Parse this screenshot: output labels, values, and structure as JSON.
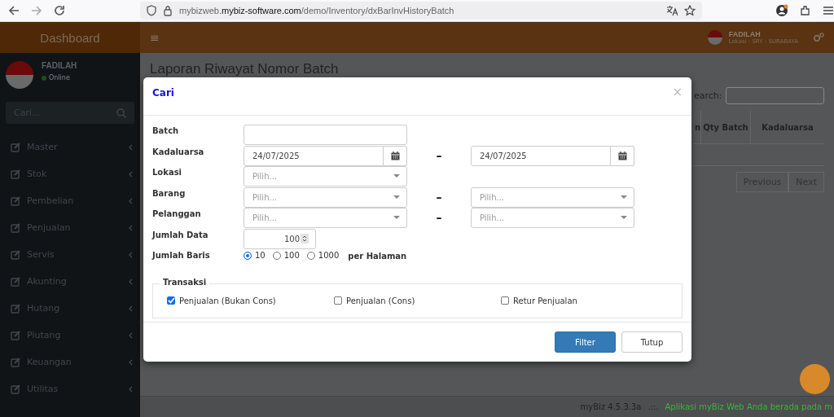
{
  "browser": {
    "url": "mybizweb.**mybiz-software.com**/demo/Inventory/dxBarInvHistoryBatch"
  },
  "header": {
    "brand": "Dashboard",
    "menu_glyph": "≡",
    "user_name": "FADILAH",
    "location": "Lokasi : SRY - SURABAYA"
  },
  "sidebar": {
    "user": {
      "name": "FADILAH",
      "status": "Online"
    },
    "search_placeholder": "Cari...",
    "items": [
      {
        "label": "Master"
      },
      {
        "label": "Stok"
      },
      {
        "label": "Pembelian"
      },
      {
        "label": "Penjualan"
      },
      {
        "label": "Servis"
      },
      {
        "label": "Akunting"
      },
      {
        "label": "Hutang"
      },
      {
        "label": "Piutang"
      },
      {
        "label": "Keuangan"
      },
      {
        "label": "Utilitas"
      }
    ]
  },
  "page": {
    "title": "Laporan Riwayat Nomor Batch",
    "search_label": "earch:",
    "table": {
      "columns": [
        "n",
        "Qty Batch",
        "Kadaluarsa"
      ]
    },
    "pagination": [
      "Previous",
      "Next"
    ]
  },
  "modal": {
    "title": "Cari",
    "close": "×",
    "fields": [
      {
        "label": "Batch",
        "kind": "text"
      },
      {
        "label": "Kadaluarsa",
        "kind": "date_range",
        "from": "24/07/2025",
        "to": "24/07/2025",
        "separator": "–"
      },
      {
        "label": "Lokasi",
        "kind": "select",
        "placeholder": "Pilih..."
      },
      {
        "label": "Barang",
        "kind": "select_range",
        "from_placeholder": "Pilih...",
        "to_placeholder": "Pilih...",
        "separator": "–"
      },
      {
        "label": "Pelanggan",
        "kind": "select_range",
        "from_placeholder": "Pilih...",
        "to_placeholder": "Pilih...",
        "separator": "–"
      },
      {
        "label": "Jumlah Data",
        "kind": "number",
        "value": "100"
      },
      {
        "label": "Jumlah Baris",
        "kind": "radio",
        "options": [
          {
            "label": "10",
            "selected": true
          },
          {
            "label": "100",
            "selected": false
          },
          {
            "label": "1000",
            "selected": false
          }
        ],
        "suffix": "per Halaman"
      }
    ],
    "transactions": {
      "legend": "Transaksi",
      "options": [
        {
          "label": "Penjualan (Bukan Cons)",
          "checked": true
        },
        {
          "label": "Penjualan (Cons)",
          "checked": false
        },
        {
          "label": "Retur Penjualan",
          "checked": false
        }
      ]
    },
    "buttons": [
      {
        "label": "Filter",
        "kind": "primary"
      },
      {
        "label": "Tutup",
        "kind": "default"
      }
    ]
  },
  "footer": {
    "version": "myBiz 4.5.3.3a",
    "separator": ".::.",
    "message": "Aplikasi myBiz Web Anda berada pada m"
  }
}
